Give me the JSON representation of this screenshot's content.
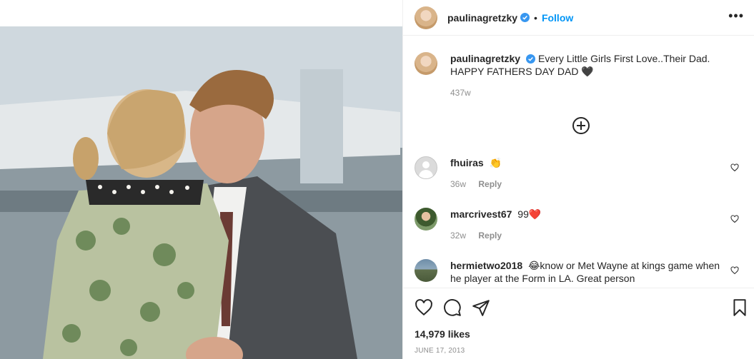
{
  "post": {
    "owner": "paulinagretzky",
    "follow_label": "Follow",
    "separator": "•",
    "more_label": "•••",
    "caption": "Every Little Girls First Love..Their Dad. HAPPY FATHERS DAY DAD",
    "caption_emoji": "🖤",
    "caption_time": "437w",
    "likes": "14,979 likes",
    "date": "JUNE 17, 2013"
  },
  "comments": [
    {
      "user": "fhuiras",
      "text": "👏",
      "time": "36w",
      "reply_label": "Reply"
    },
    {
      "user": "marcrivest67",
      "text": "99",
      "emoji": "❤️",
      "time": "32w",
      "reply_label": "Reply"
    },
    {
      "user": "hermietwo2018",
      "text": "😂know or Met Wayne at kings game when he player at the Form in LA. Great person"
    }
  ],
  "icons": {
    "verified": "verified-badge-icon",
    "more": "more-options-icon",
    "load_more": "plus-circle-icon",
    "like": "heart-icon",
    "comment": "comment-bubble-icon",
    "share": "paper-plane-icon",
    "save": "bookmark-icon"
  },
  "colors": {
    "accent": "#0095f6",
    "muted": "#8e8e8e",
    "text": "#262626",
    "like_red": "#ed4956"
  }
}
